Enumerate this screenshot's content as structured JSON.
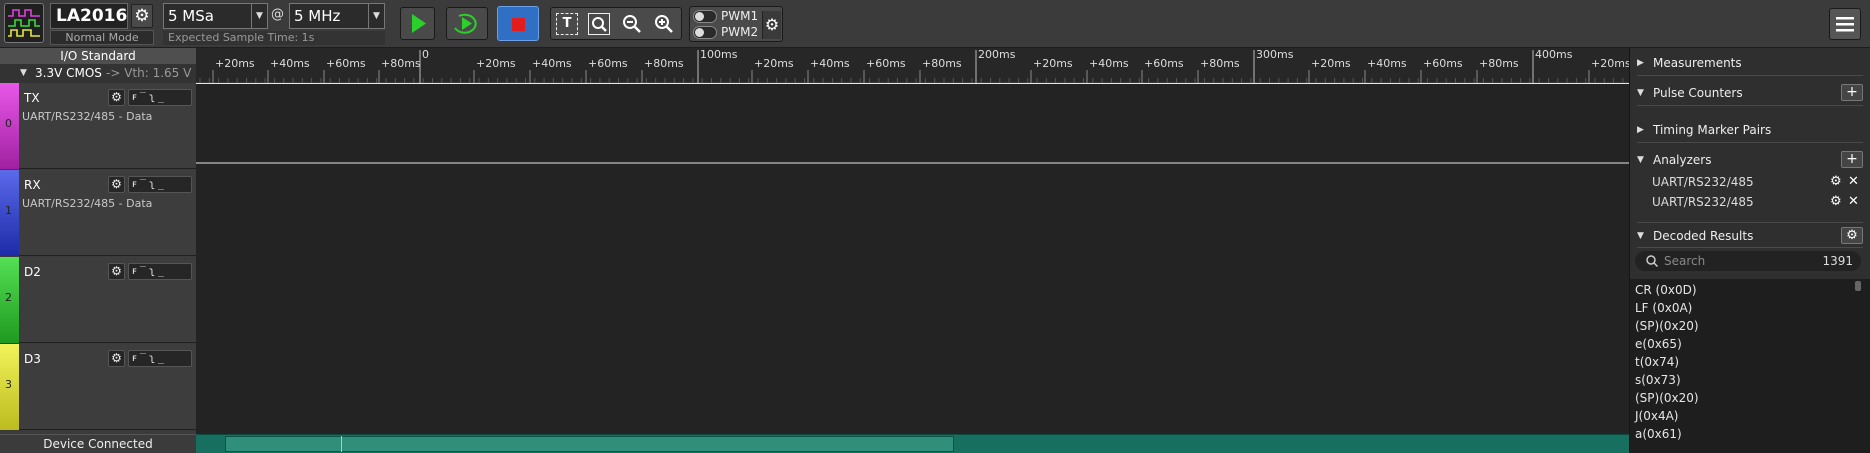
{
  "device": {
    "name": "LA2016",
    "mode": "Normal Mode"
  },
  "toolbar": {
    "sample_count": "5 MSa",
    "at": "@",
    "sample_rate": "5 MHz",
    "expected_time": "Expected Sample Time: 1s",
    "pwm1": "PWM1",
    "pwm2": "PWM2"
  },
  "io": {
    "title": "I/O Standard",
    "standard": "3.3V CMOS",
    "vth": "-> Vth: 1.65 V"
  },
  "channels": [
    {
      "num": "0",
      "name": "TX",
      "sub": "UART/RS232/485 - Data",
      "color": "#d63ad6"
    },
    {
      "num": "1",
      "name": "RX",
      "sub": "UART/RS232/485 - Data",
      "color": "#3a4ad6"
    },
    {
      "num": "2",
      "name": "D2",
      "sub": "",
      "color": "#2ec82e"
    },
    {
      "num": "3",
      "name": "D3",
      "sub": "",
      "color": "#e6e63a"
    }
  ],
  "status": {
    "connected": "Device Connected"
  },
  "ruler": {
    "labels": [
      {
        "t": "+20ms",
        "x": 0.012
      },
      {
        "t": "+40ms",
        "x": 0.05
      },
      {
        "t": "+60ms",
        "x": 0.089
      },
      {
        "t": "+80ms",
        "x": 0.128
      },
      {
        "t": "0",
        "x": 0.156
      },
      {
        "t": "+20ms",
        "x": 0.194
      },
      {
        "t": "+40ms",
        "x": 0.233
      },
      {
        "t": "+60ms",
        "x": 0.272
      },
      {
        "t": "+80ms",
        "x": 0.311
      },
      {
        "t": "100ms",
        "x": 0.35
      },
      {
        "t": "+20ms",
        "x": 0.388
      },
      {
        "t": "+40ms",
        "x": 0.427
      },
      {
        "t": "+60ms",
        "x": 0.466
      },
      {
        "t": "+80ms",
        "x": 0.505
      },
      {
        "t": "200ms",
        "x": 0.544
      },
      {
        "t": "+20ms",
        "x": 0.583
      },
      {
        "t": "+40ms",
        "x": 0.622
      },
      {
        "t": "+60ms",
        "x": 0.66
      },
      {
        "t": "+80ms",
        "x": 0.699
      },
      {
        "t": "300ms",
        "x": 0.738
      },
      {
        "t": "+20ms",
        "x": 0.777
      },
      {
        "t": "+40ms",
        "x": 0.816
      },
      {
        "t": "+60ms",
        "x": 0.855
      },
      {
        "t": "+80ms",
        "x": 0.894
      },
      {
        "t": "400ms",
        "x": 0.933
      },
      {
        "t": "+20ms",
        "x": 0.972
      }
    ]
  },
  "sidebar": {
    "measurements": "Measurements",
    "pulse_counters": "Pulse Counters",
    "timing_pairs": "Timing Marker Pairs",
    "analyzers": "Analyzers",
    "analyzer_items": [
      "UART/RS232/485",
      "UART/RS232/485"
    ],
    "decoded": "Decoded Results",
    "search_placeholder": "Search",
    "count": "1391",
    "results": [
      "CR (0x0D)",
      "LF (0x0A)",
      "(SP)(0x20)",
      "e(0x65)",
      "t(0x74)",
      "s(0x73)",
      "(SP)(0x20)",
      "J(0x4A)",
      "a(0x61)"
    ]
  }
}
